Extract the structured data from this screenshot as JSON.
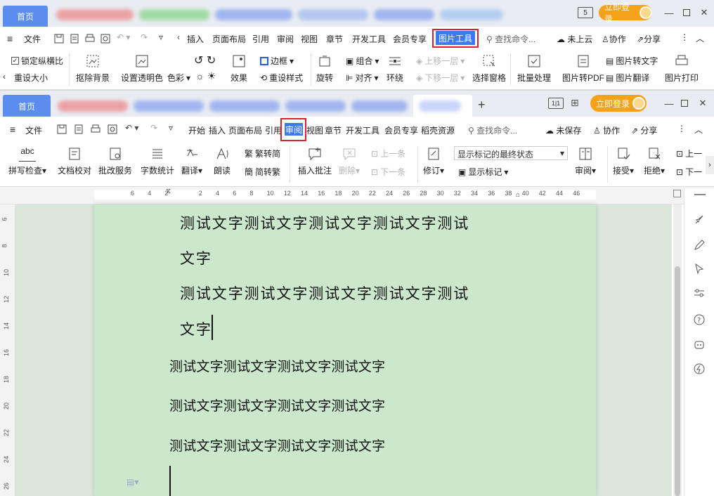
{
  "window1": {
    "home_tab": "首页",
    "login_label": "立即登录",
    "badge": "5",
    "menu": {
      "file": "文件",
      "tabs": [
        "插入",
        "页面布局",
        "引用",
        "审阅",
        "视图",
        "章节",
        "开发工具",
        "会员专享",
        "图片工具"
      ],
      "search": "查找命令...",
      "cloud": "未上云",
      "collab": "协作",
      "share": "分享"
    },
    "ribbon": {
      "lock_ratio": "锁定纵横比",
      "reset_size": "重设大小",
      "remove_bg": "抠除背景",
      "set_transparent": "设置透明色",
      "color": "色彩",
      "effect": "效果",
      "border": "边框",
      "reset_style": "重设样式",
      "rotate": "旋转",
      "group": "组合",
      "align": "对齐",
      "wrap": "环绕",
      "bring_forward": "上移一层",
      "send_backward": "下移一层",
      "selection_pane": "选择窗格",
      "batch": "批量处理",
      "to_pdf": "图片转PDF",
      "to_text": "图片转文字",
      "translate": "图片翻译",
      "print": "图片打印"
    }
  },
  "window2": {
    "home_tab": "首页",
    "login_label": "立即登录",
    "menu": {
      "file": "文件",
      "tabs": [
        "开始",
        "插入",
        "页面布局",
        "引用",
        "审阅",
        "视图",
        "章节",
        "开发工具",
        "会员专享",
        "稻壳资源"
      ],
      "search": "查找命令...",
      "unsaved": "未保存",
      "collab": "协作",
      "share": "分享"
    },
    "ribbon": {
      "abc": "abc",
      "spell": "拼写检查",
      "proof": "文档校对",
      "revise_service": "批改服务",
      "word_count": "字数统计",
      "translate": "翻译",
      "read": "朗读",
      "trad": "繁转简",
      "simp": "简转繁",
      "insert_comment": "插入批注",
      "delete": "删除",
      "prev": "上一条",
      "next": "下一条",
      "track": "修订",
      "markup_state": "显示标记的最终状态",
      "show_markup": "显示标记",
      "review": "审阅",
      "accept": "接受",
      "reject": "拒绝",
      "prev2": "上一",
      "next2": "下一"
    },
    "ruler_ticks": [
      "6",
      "4",
      "2",
      "",
      "2",
      "4",
      "6",
      "8",
      "10",
      "12",
      "14",
      "16",
      "18",
      "20",
      "22",
      "24",
      "26",
      "28",
      "30",
      "32",
      "34",
      "36",
      "38",
      "40",
      "42",
      "44",
      "46"
    ],
    "vruler_ticks": [
      "6",
      "8",
      "10",
      "12",
      "14",
      "16",
      "18",
      "20",
      "22",
      "24",
      "26"
    ]
  },
  "document": {
    "lines": [
      "测试文字测试文字测试文字测试文字测试",
      "文字",
      "测试文字测试文字测试文字测试文字测试",
      "文字",
      "测试文字测试文字测试文字测试文字",
      "测试文字测试文字测试文字测试文字",
      "测试文字测试文字测试文字测试文字"
    ]
  },
  "colors": {
    "accent": "#5b8def",
    "highlight": "#e0202a",
    "login": "#f4a217",
    "page": "#cce8cc"
  }
}
